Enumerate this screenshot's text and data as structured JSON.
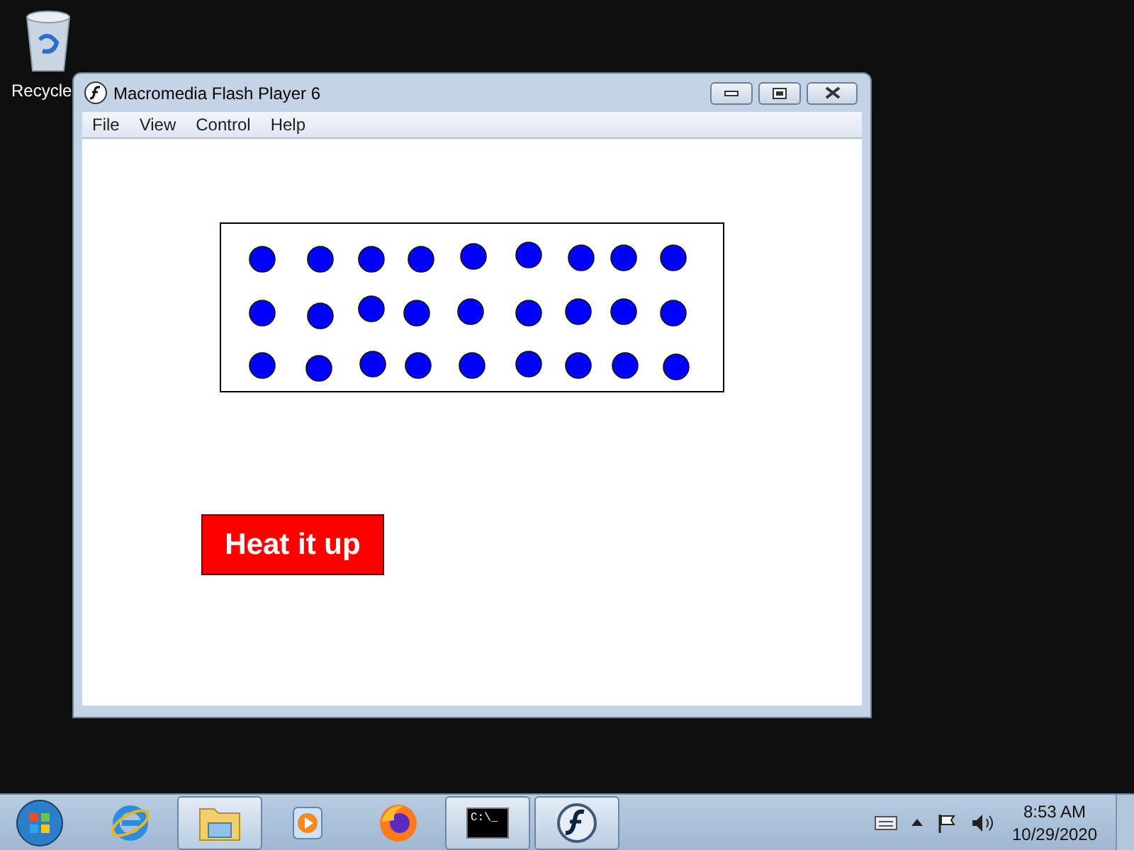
{
  "desktop_icons": [
    {
      "label": "Recycle"
    }
  ],
  "window": {
    "title": "Macromedia Flash Player 6",
    "menu": [
      "File",
      "View",
      "Control",
      "Help"
    ],
    "button": "Heat it up"
  },
  "taskbar": {
    "items": [
      {
        "kind": "ie",
        "running": false
      },
      {
        "kind": "folder",
        "running": true
      },
      {
        "kind": "media",
        "running": false
      },
      {
        "kind": "firefox",
        "running": false
      },
      {
        "kind": "cmd",
        "running": true,
        "label": "C:\\_"
      },
      {
        "kind": "flash",
        "running": true
      }
    ],
    "time": "8:53 AM",
    "date": "10/29/2020"
  }
}
